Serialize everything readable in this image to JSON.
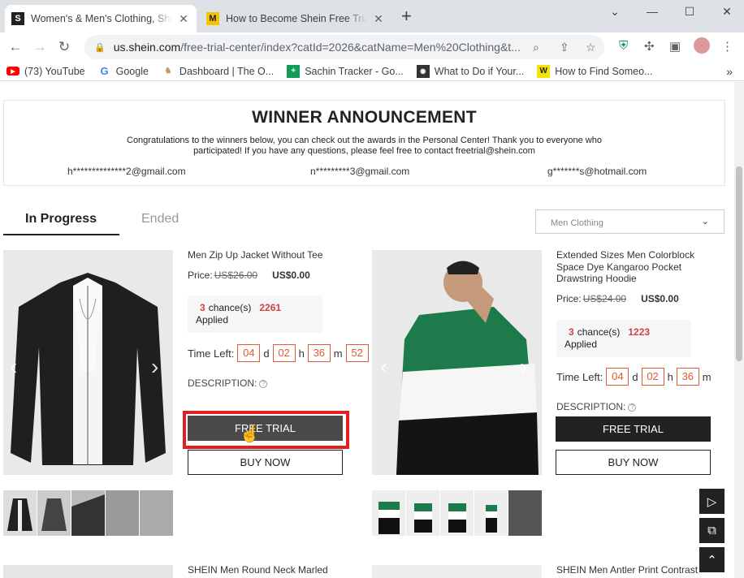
{
  "browser": {
    "tabs": [
      {
        "title": "Women's & Men's Clothing, Shop",
        "favicon": "S",
        "close": "✕"
      },
      {
        "title": "How to Become Shein Free Trial t",
        "favicon": "M",
        "close": "✕"
      }
    ],
    "new_tab": "+",
    "url_host": "us.shein.com",
    "url_path": "/free-trial-center/index?catId=2026&catName=Men%20Clothing&t...",
    "bookmarks": [
      {
        "label": "(73) YouTube",
        "icon": "youtube-icon"
      },
      {
        "label": "Google",
        "icon": "google-icon"
      },
      {
        "label": "Dashboard | The O...",
        "icon": "dashboard-icon"
      },
      {
        "label": "Sachin Tracker - Go...",
        "icon": "sheets-icon"
      },
      {
        "label": "What to Do if Your...",
        "icon": "page-icon"
      },
      {
        "label": "How to Find Someo...",
        "icon": "w-icon"
      }
    ],
    "more": "»"
  },
  "winner": {
    "title": "WINNER ANNOUNCEMENT",
    "message": "Congratulations to the winners below, you can check out the awards in the Personal Center! Thank you to everyone who participated! If you have any questions, please feel free to contact freetrial@shein.com",
    "emails": [
      "h**************2@gmail.com",
      "n*********3@gmail.com",
      "g*******s@hotmail.com"
    ]
  },
  "tabs": {
    "in_progress": "In Progress",
    "ended": "Ended"
  },
  "category_select": {
    "value": "Men Clothing",
    "chevron": "⌄"
  },
  "products": [
    {
      "name": "Men Zip Up Jacket Without Tee",
      "price_label": "Price:",
      "old_price": "US$26.00",
      "new_price": "US$0.00",
      "chances": "3",
      "chances_label": "chance(s)",
      "applied_count": "2261",
      "applied_label": "Applied",
      "time_left_label": "Time Left:",
      "time": [
        "04",
        "02",
        "36",
        "52"
      ],
      "units": [
        "d",
        "h",
        "m"
      ],
      "description_label": "DESCRIPTION:",
      "free_trial": "FREE TRIAL",
      "buy_now": "BUY NOW"
    },
    {
      "name": "Extended Sizes Men Colorblock Space Dye Kangaroo Pocket Drawstring Hoodie",
      "price_label": "Price:",
      "old_price": "US$24.00",
      "new_price": "US$0.00",
      "chances": "3",
      "chances_label": "chance(s)",
      "applied_count": "1223",
      "applied_label": "Applied",
      "time_left_label": "Time Left:",
      "time": [
        "04",
        "02",
        "36"
      ],
      "units": [
        "d",
        "h",
        "m"
      ],
      "description_label": "DESCRIPTION:",
      "free_trial": "FREE TRIAL",
      "buy_now": "BUY NOW"
    }
  ],
  "next_products": [
    "SHEIN Men Round Neck Marled",
    "SHEIN Men Antler Print Contrast"
  ]
}
